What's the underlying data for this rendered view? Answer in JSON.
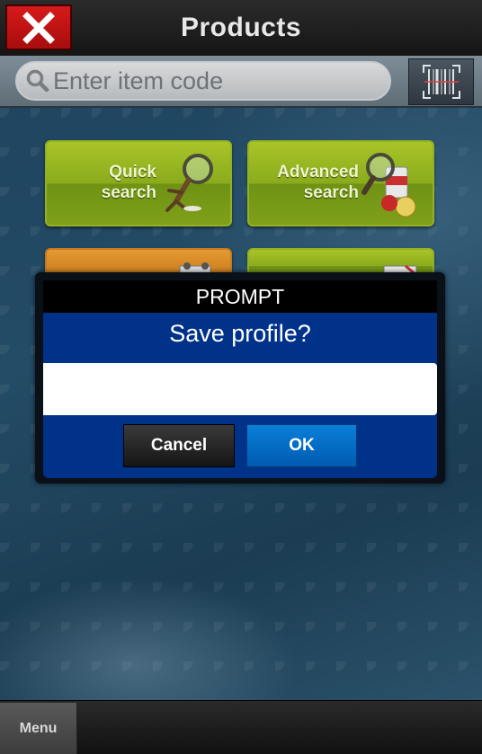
{
  "header": {
    "title": "Products",
    "close_icon": "close-icon"
  },
  "search": {
    "placeholder": "Enter item code",
    "search_icon": "search-icon",
    "scan_icon": "barcode-scan-icon"
  },
  "tiles": [
    {
      "line1": "Quick",
      "line2": "search",
      "icon": "magnifier-runner-icon"
    },
    {
      "line1": "Advanced",
      "line2": "search",
      "icon": "magnifier-products-icon"
    }
  ],
  "dialog": {
    "title": "PROMPT",
    "message": "Save profile?",
    "input_value": "",
    "cancel_label": "Cancel",
    "ok_label": "OK"
  },
  "footer": {
    "menu_label": "Menu"
  },
  "colors": {
    "tile_green": "#8aab1c",
    "tile_orange": "#e49a34",
    "dialog_blue": "#00328a",
    "ok_blue": "#0a7fd8",
    "close_red": "#c81414"
  }
}
